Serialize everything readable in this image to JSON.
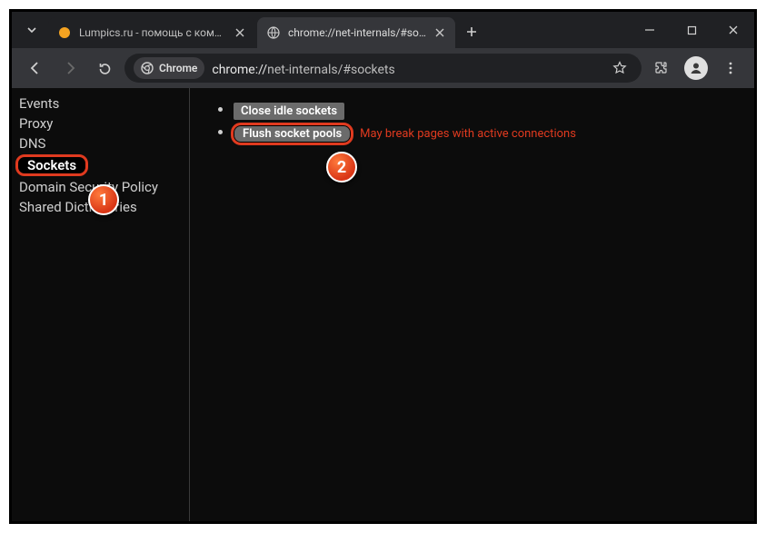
{
  "window": {
    "tabs": [
      {
        "title": "Lumpics.ru - помощь с компью",
        "active": false,
        "favicon": "orange-dot"
      },
      {
        "title": "chrome://net-internals/#sockets",
        "active": true,
        "favicon": "globe"
      }
    ]
  },
  "toolbar": {
    "chip_label": "Chrome",
    "url_scheme": "chrome://",
    "url_rest": "net-internals/#sockets"
  },
  "sidebar": {
    "items": [
      {
        "label": "Events",
        "selected": false
      },
      {
        "label": "Proxy",
        "selected": false
      },
      {
        "label": "DNS",
        "selected": false
      },
      {
        "label": "Sockets",
        "selected": true
      },
      {
        "label": "Domain Security Policy",
        "selected": false
      },
      {
        "label": "Shared Dictionaries",
        "selected": false
      }
    ]
  },
  "content": {
    "buttons": {
      "close_idle": "Close idle sockets",
      "flush_pools": "Flush socket pools"
    },
    "warning": "May break pages with active connections"
  },
  "callouts": {
    "one": "1",
    "two": "2"
  }
}
